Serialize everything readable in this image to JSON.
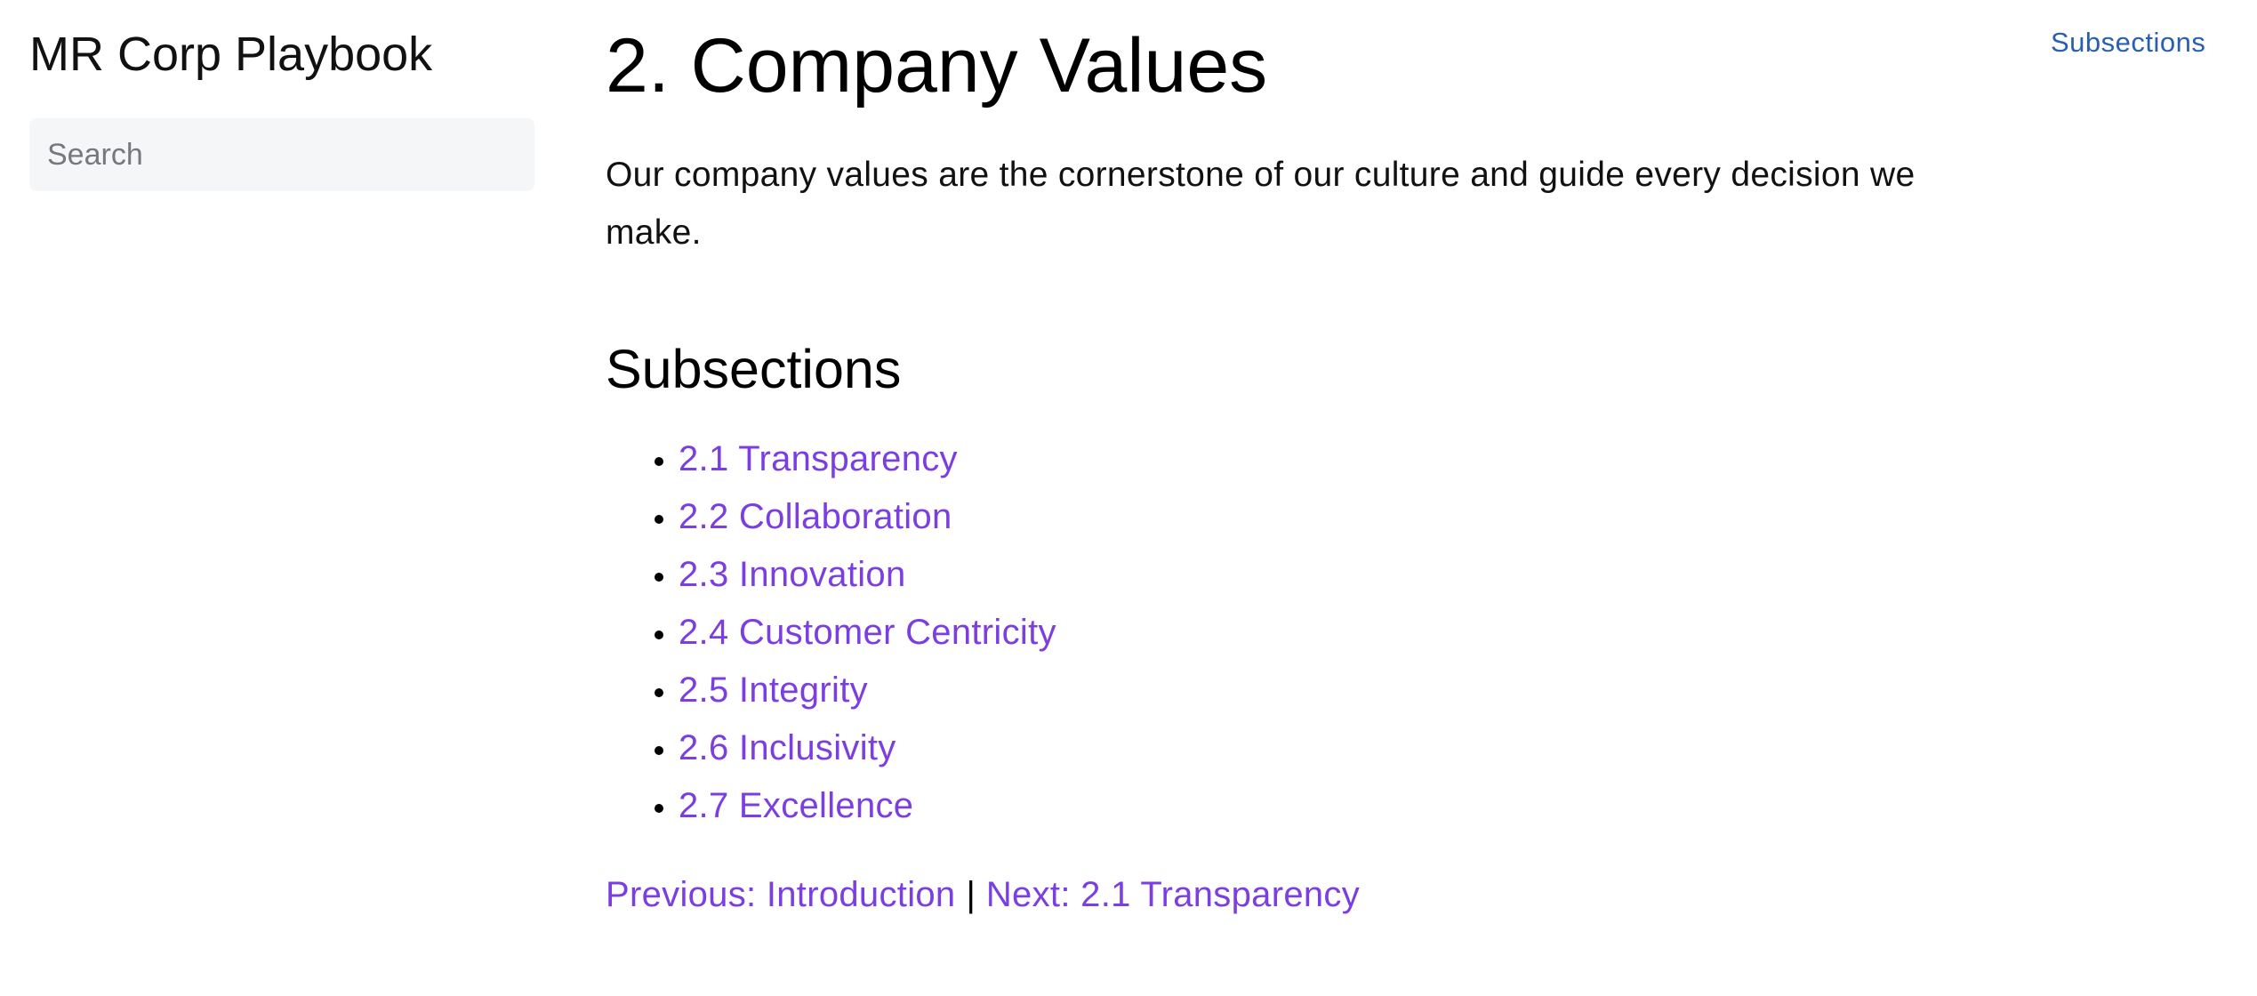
{
  "sidebar": {
    "site_title": "MR Corp Playbook",
    "search": {
      "placeholder": "Search",
      "value": ""
    }
  },
  "header": {
    "toc_link": "Subsections"
  },
  "main": {
    "title": "2. Company Values",
    "intro": "Our company values are the cornerstone of our culture and guide every decision we make.",
    "subsections_heading": "Subsections",
    "subsections": [
      {
        "label": "2.1 Transparency"
      },
      {
        "label": "2.2 Collaboration"
      },
      {
        "label": "2.3 Innovation"
      },
      {
        "label": "2.4 Customer Centricity"
      },
      {
        "label": "2.5 Integrity"
      },
      {
        "label": "2.6 Inclusivity"
      },
      {
        "label": "2.7 Excellence"
      }
    ],
    "pager": {
      "previous": "Previous: Introduction",
      "separator": "|",
      "next": "Next: 2.1 Transparency"
    }
  },
  "colors": {
    "link": "#7b3ee0",
    "toc_link": "#2a5fb0",
    "search_bg": "#f5f6f8",
    "text": "#000000"
  }
}
